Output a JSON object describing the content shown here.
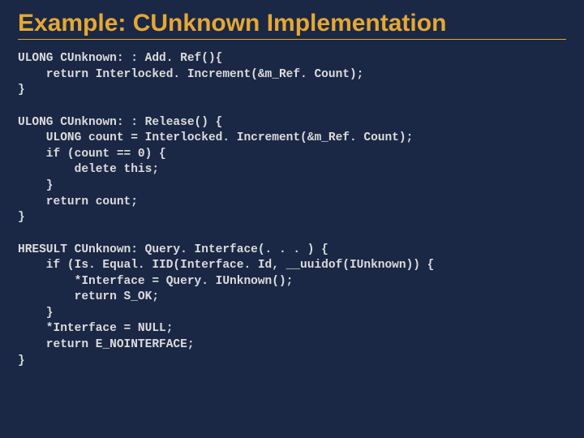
{
  "title": "Example: CUnknown Implementation",
  "code": {
    "block1": "ULONG CUnknown: : Add. Ref(){\n    return Interlocked. Increment(&m_Ref. Count);\n}",
    "block2": "ULONG CUnknown: : Release() {\n    ULONG count = Interlocked. Increment(&m_Ref. Count);\n    if (count == 0) {\n        delete this;\n    }\n    return count;\n}",
    "block3": "HRESULT CUnknown: Query. Interface(. . . ) {\n    if (Is. Equal. IID(Interface. Id, __uuidof(IUnknown)) {\n        *Interface = Query. IUnknown();\n        return S_OK;\n    }\n    *Interface = NULL;\n    return E_NOINTERFACE;\n}"
  }
}
